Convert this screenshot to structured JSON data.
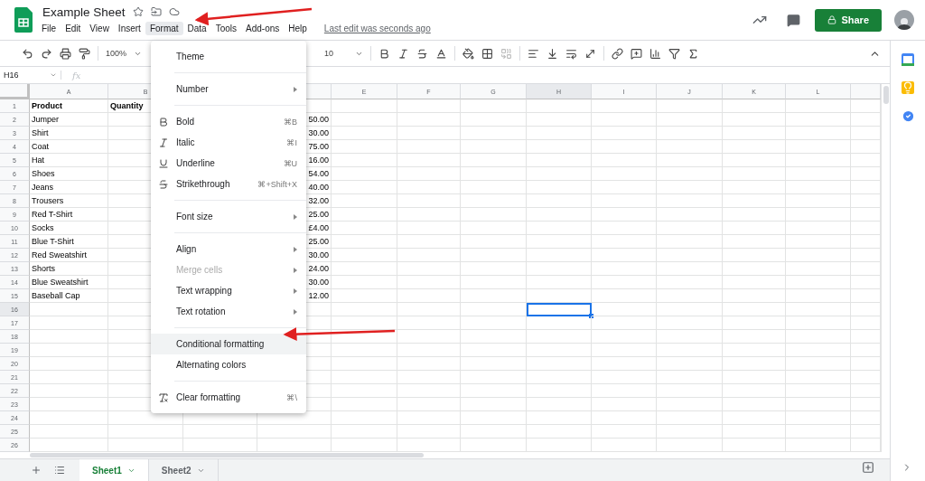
{
  "document": {
    "title": "Example Sheet",
    "last_edit": "Last edit was seconds ago"
  },
  "menu_bar": [
    {
      "label": "File",
      "selected": false
    },
    {
      "label": "Edit",
      "selected": false
    },
    {
      "label": "View",
      "selected": false
    },
    {
      "label": "Insert",
      "selected": false
    },
    {
      "label": "Format",
      "selected": true
    },
    {
      "label": "Data",
      "selected": false
    },
    {
      "label": "Tools",
      "selected": false
    },
    {
      "label": "Add-ons",
      "selected": false
    },
    {
      "label": "Help",
      "selected": false
    }
  ],
  "share_button": {
    "label": "Share"
  },
  "toolbar": {
    "zoom": "100%",
    "font_size": "10"
  },
  "formula_bar": {
    "cell_reference": "H16",
    "fx": "fx"
  },
  "columns": [
    {
      "label": "A",
      "selected": false
    },
    {
      "label": "B",
      "selected": false
    },
    {},
    {},
    {
      "label": "E",
      "selected": false
    },
    {
      "label": "F",
      "selected": false
    },
    {
      "label": "G",
      "selected": false
    },
    {
      "label": "H",
      "selected": true
    },
    {
      "label": "I",
      "selected": false
    },
    {
      "label": "J",
      "selected": false
    },
    {
      "label": "K",
      "selected": false
    },
    {
      "label": "L",
      "selected": false
    },
    {}
  ],
  "rows": [
    {
      "number": "1",
      "selected": false,
      "bold": true,
      "product": "Product",
      "quantity": "Quantity"
    },
    {
      "number": "2",
      "selected": false,
      "bold": false,
      "product": "Jumper",
      "column_4": "50.00"
    },
    {
      "number": "3",
      "selected": false,
      "bold": false,
      "product": "Shirt",
      "column_4": "30.00"
    },
    {
      "number": "4",
      "selected": false,
      "bold": false,
      "product": "Coat",
      "column_4": "75.00"
    },
    {
      "number": "5",
      "selected": false,
      "bold": false,
      "product": "Hat",
      "column_4": "16.00"
    },
    {
      "number": "6",
      "selected": false,
      "bold": false,
      "product": "Shoes",
      "column_4": "54.00"
    },
    {
      "number": "7",
      "selected": false,
      "bold": false,
      "product": "Jeans",
      "column_4": "40.00"
    },
    {
      "number": "8",
      "selected": false,
      "bold": false,
      "product": "Trousers",
      "column_4": "32.00"
    },
    {
      "number": "9",
      "selected": false,
      "bold": false,
      "product": "Red T-Shirt",
      "column_4": "25.00"
    },
    {
      "number": "10",
      "selected": false,
      "bold": false,
      "product": "Socks",
      "column_4": "£4.00"
    },
    {
      "number": "11",
      "selected": false,
      "bold": false,
      "product": "Blue T-Shirt",
      "column_4": "25.00"
    },
    {
      "number": "12",
      "selected": false,
      "bold": false,
      "product": "Red Sweatshirt",
      "column_4": "30.00"
    },
    {
      "number": "13",
      "selected": false,
      "bold": false,
      "product": "Shorts",
      "column_4": "24.00"
    },
    {
      "number": "14",
      "selected": false,
      "bold": false,
      "product": "Blue Sweatshirt",
      "column_4": "30.00"
    },
    {
      "number": "15",
      "selected": false,
      "bold": false,
      "product": "Baseball Cap",
      "column_4": "12.00"
    },
    {
      "number": "16",
      "selected": true
    },
    {
      "number": "17",
      "selected": false
    },
    {
      "number": "18",
      "selected": false
    },
    {
      "number": "19",
      "selected": false
    },
    {
      "number": "20",
      "selected": false
    },
    {
      "number": "21",
      "selected": false
    },
    {
      "number": "22",
      "selected": false
    },
    {
      "number": "23",
      "selected": false
    },
    {
      "number": "24",
      "selected": false
    },
    {
      "number": "25",
      "selected": false
    },
    {
      "number": "26",
      "selected": false
    }
  ],
  "format_menu": [
    [
      {
        "label": "Theme",
        "submenu": false,
        "disabled": false,
        "highlighted": false
      }
    ],
    [
      {
        "label": "Number",
        "submenu": true,
        "disabled": false,
        "highlighted": false
      }
    ],
    [
      {
        "label": "Bold",
        "kind": "bold",
        "shortcut": "⌘B",
        "submenu": false,
        "disabled": false,
        "highlighted": false
      },
      {
        "label": "Italic",
        "kind": "italic",
        "shortcut": "⌘I",
        "submenu": false,
        "disabled": false,
        "highlighted": false
      },
      {
        "label": "Underline",
        "kind": "underline",
        "shortcut": "⌘U",
        "submenu": false,
        "disabled": false,
        "highlighted": false
      },
      {
        "label": "Strikethrough",
        "kind": "strikethrough",
        "shortcut": "⌘+Shift+X",
        "submenu": false,
        "disabled": false,
        "highlighted": false
      }
    ],
    [
      {
        "label": "Font size",
        "submenu": true,
        "disabled": false,
        "highlighted": false
      }
    ],
    [
      {
        "label": "Align",
        "submenu": true,
        "disabled": false,
        "highlighted": false
      },
      {
        "label": "Merge cells",
        "submenu": true,
        "disabled": true,
        "highlighted": false
      },
      {
        "label": "Text wrapping",
        "submenu": true,
        "disabled": false,
        "highlighted": false
      },
      {
        "label": "Text rotation",
        "submenu": true,
        "disabled": false,
        "highlighted": false
      }
    ],
    [
      {
        "label": "Conditional formatting",
        "submenu": false,
        "disabled": false,
        "highlighted": true
      },
      {
        "label": "Alternating colors",
        "submenu": false,
        "disabled": false,
        "highlighted": false
      }
    ],
    [
      {
        "label": "Clear formatting",
        "kind": "clear",
        "shortcut": "⌘\\",
        "submenu": false,
        "disabled": false,
        "highlighted": false
      }
    ]
  ],
  "sheet_tabs": [
    {
      "label": "Sheet1",
      "selected": true
    },
    {
      "label": "Sheet2",
      "selected": false
    }
  ]
}
